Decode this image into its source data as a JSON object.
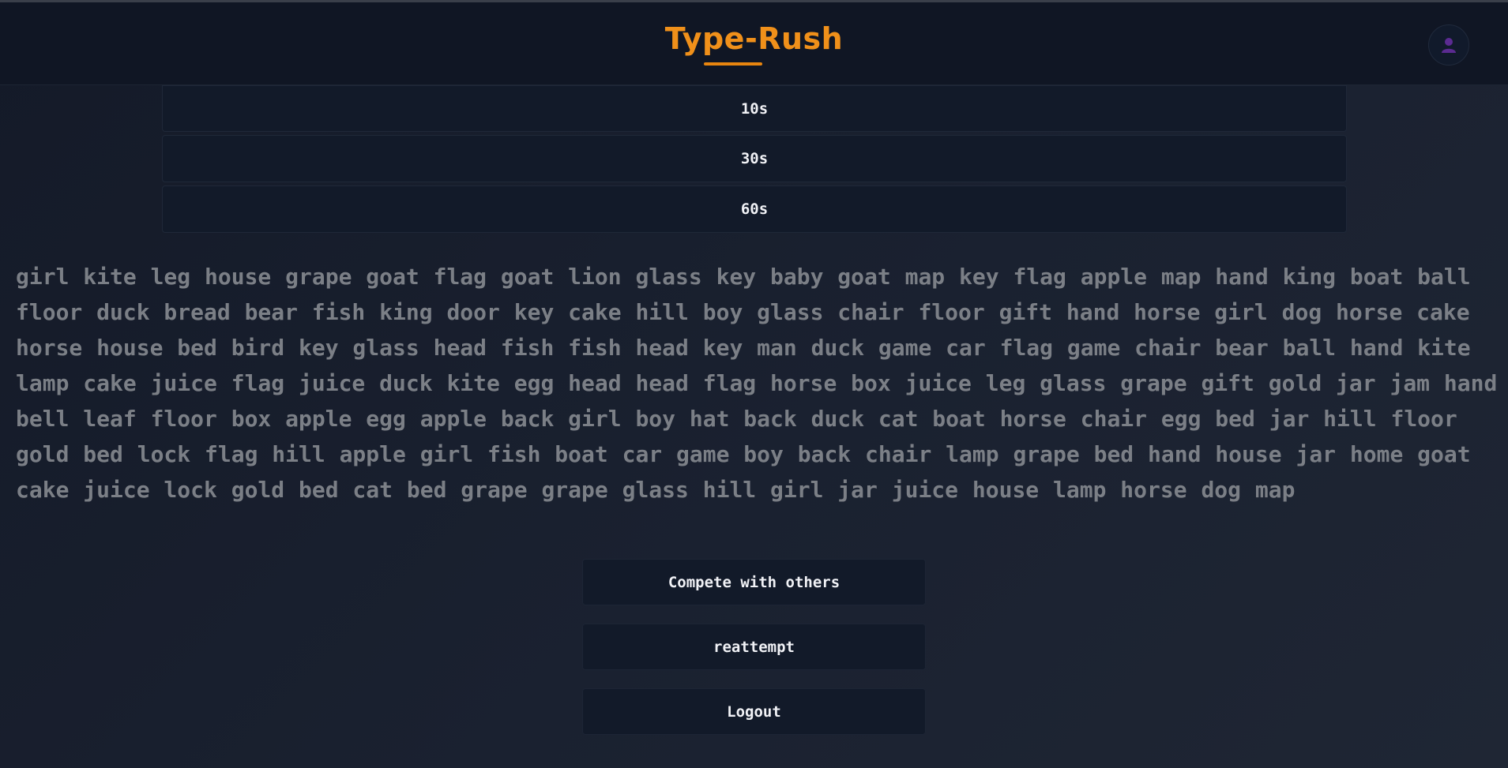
{
  "app": {
    "title": "Type-Rush",
    "accent_color": "#f0901a"
  },
  "header": {
    "profile_icon": "user-icon",
    "profile_icon_color": "#5b2b91"
  },
  "time_options": [
    {
      "label": "10s"
    },
    {
      "label": "30s"
    },
    {
      "label": "60s"
    }
  ],
  "typing_text": "girl kite leg house grape goat flag goat lion glass key baby goat map key flag apple map hand king boat ball floor duck bread bear fish king door key cake hill boy glass chair floor gift hand horse girl dog horse cake horse house bed bird key glass head fish fish head key man duck game car flag game chair bear ball hand kite lamp cake juice flag juice duck kite egg head head flag horse box juice leg glass grape gift gold jar jam hand bell leaf floor box apple egg apple back girl boy hat back duck cat boat horse chair egg bed jar hill floor gold bed lock flag hill apple girl fish boat car game boy back chair lamp grape bed hand house jar home goat cake juice lock gold bed cat bed grape grape glass hill girl jar juice house lamp horse dog map",
  "actions": {
    "compete_label": "Compete with others",
    "reattempt_label": "reattempt",
    "logout_label": "Logout"
  }
}
